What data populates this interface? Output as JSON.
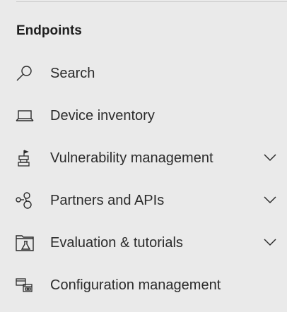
{
  "section": {
    "title": "Endpoints"
  },
  "items": [
    {
      "label": "Search",
      "icon": "search-icon",
      "expandable": false
    },
    {
      "label": "Device inventory",
      "icon": "laptop-icon",
      "expandable": false
    },
    {
      "label": "Vulnerability management",
      "icon": "vulnerability-icon",
      "expandable": true
    },
    {
      "label": "Partners and APIs",
      "icon": "partners-icon",
      "expandable": true
    },
    {
      "label": "Evaluation & tutorials",
      "icon": "evaluation-icon",
      "expandable": true
    },
    {
      "label": "Configuration management",
      "icon": "configuration-icon",
      "expandable": false
    }
  ]
}
